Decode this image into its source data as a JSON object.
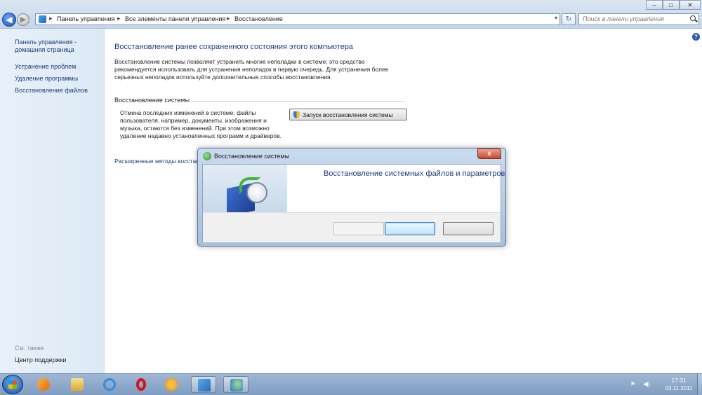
{
  "window": {
    "controls": {
      "minimize": "–",
      "maximize": "□",
      "close": "✕"
    }
  },
  "nav": {
    "back_glyph": "◀",
    "forward_glyph": "▶",
    "breadcrumb": [
      "Панель управления",
      "Все элементы панели управления",
      "Восстановление"
    ],
    "breadcrumb_sep": "▸",
    "dropdown_glyph": "▾",
    "refresh_glyph": "↻",
    "search_placeholder": "Поиск в панели управления"
  },
  "sidebar": {
    "items": [
      {
        "label": "Панель управления -"
      },
      {
        "label": "домашняя страница"
      },
      {
        "label": "Устранение проблем"
      },
      {
        "label": "Удаление программы"
      },
      {
        "label": "Восстановление файлов"
      }
    ],
    "see_also_label": "См. также",
    "see_also_items": [
      {
        "label": "Центр поддержки"
      }
    ]
  },
  "main": {
    "help_glyph": "?",
    "title": "Восстановление ранее сохраненного состояния этого компьютера",
    "description": "Восстановление системы позволяет устранить многие неполадки в системе; это средство рекомендуется использовать для устранения неполадок в первую очередь. Для устранения более серьезных неполадок используйте дополнительные способы восстановления.",
    "section_title": "Восстановление системы",
    "section_description": "Отмена последних изменений в системе; файлы пользователя, например, документы, изображения и музыка, остаются без изменений. При этом возможно удаление недавно установленных программ и драйверов.",
    "launch_button": "Запуск восстановления системы",
    "advanced_link": "Расширенные методы восстан"
  },
  "dialog": {
    "title": "Восстановление системы",
    "close_glyph": "x",
    "heading": "Восстановление системных файлов и параметров",
    "buttons": {
      "back": "",
      "next": "",
      "cancel": ""
    }
  },
  "taskbar": {
    "clock_time": "17:31",
    "clock_date": "03.11.2011"
  },
  "colors": {
    "link": "#1a3f7a",
    "title_blue": "#1e3c82",
    "taskbar": "#7f9cc0"
  }
}
